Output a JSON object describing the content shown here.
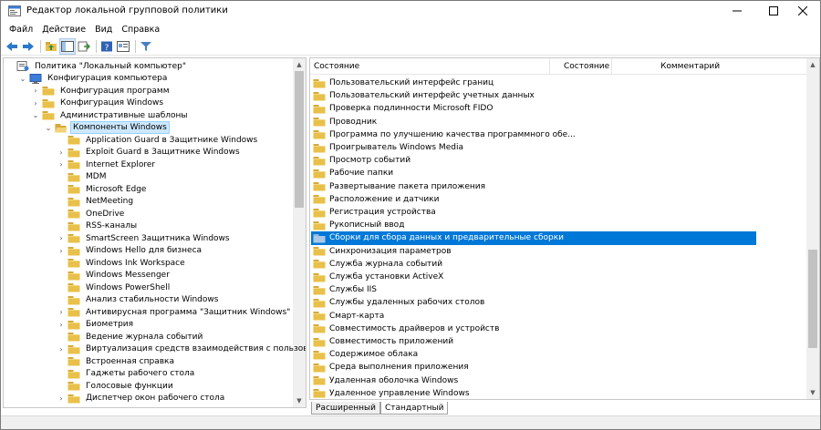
{
  "window": {
    "title": "Редактор локальной групповой политики"
  },
  "menu": [
    "Файл",
    "Действие",
    "Вид",
    "Справка"
  ],
  "toolbar": {
    "buttons": [
      "back-icon",
      "forward-icon",
      "up-folder-icon",
      "console-tree-icon",
      "export-list-icon",
      "help-icon",
      "properties-icon",
      "filter-icon"
    ]
  },
  "tree": {
    "items": [
      {
        "label": "Политика \"Локальный компьютер\"",
        "level": 0,
        "expander": "",
        "icon": "policy"
      },
      {
        "label": "Конфигурация компьютера",
        "level": 1,
        "expander": "▾",
        "icon": "computer"
      },
      {
        "label": "Конфигурация программ",
        "level": 2,
        "expander": "›",
        "icon": "folder"
      },
      {
        "label": "Конфигурация Windows",
        "level": 2,
        "expander": "›",
        "icon": "folder"
      },
      {
        "label": "Административные шаблоны",
        "level": 2,
        "expander": "▾",
        "icon": "folder"
      },
      {
        "label": "Компоненты Windows",
        "level": 3,
        "expander": "▾",
        "icon": "folder-open",
        "selected": true
      },
      {
        "label": "Application Guard в Защитнике Windows",
        "level": 4,
        "expander": "",
        "icon": "folder"
      },
      {
        "label": "Exploit Guard в Защитнике Windows",
        "level": 4,
        "expander": "›",
        "icon": "folder"
      },
      {
        "label": "Internet Explorer",
        "level": 4,
        "expander": "›",
        "icon": "folder"
      },
      {
        "label": "MDM",
        "level": 4,
        "expander": "",
        "icon": "folder"
      },
      {
        "label": "Microsoft Edge",
        "level": 4,
        "expander": "",
        "icon": "folder"
      },
      {
        "label": "NetMeeting",
        "level": 4,
        "expander": "",
        "icon": "folder"
      },
      {
        "label": "OneDrive",
        "level": 4,
        "expander": "",
        "icon": "folder"
      },
      {
        "label": "RSS-каналы",
        "level": 4,
        "expander": "",
        "icon": "folder"
      },
      {
        "label": "SmartScreen Защитника Windows",
        "level": 4,
        "expander": "›",
        "icon": "folder"
      },
      {
        "label": "Windows Hello для бизнеса",
        "level": 4,
        "expander": "›",
        "icon": "folder"
      },
      {
        "label": "Windows Ink Workspace",
        "level": 4,
        "expander": "",
        "icon": "folder"
      },
      {
        "label": "Windows Messenger",
        "level": 4,
        "expander": "",
        "icon": "folder"
      },
      {
        "label": "Windows PowerShell",
        "level": 4,
        "expander": "",
        "icon": "folder"
      },
      {
        "label": "Анализ стабильности Windows",
        "level": 4,
        "expander": "",
        "icon": "folder"
      },
      {
        "label": "Антивирусная программа \"Защитник Windows\"",
        "level": 4,
        "expander": "›",
        "icon": "folder"
      },
      {
        "label": "Биометрия",
        "level": 4,
        "expander": "›",
        "icon": "folder"
      },
      {
        "label": "Ведение журнала событий",
        "level": 4,
        "expander": "",
        "icon": "folder"
      },
      {
        "label": "Виртуализация средств взаимодействия с пользователем (",
        "level": 4,
        "expander": "›",
        "icon": "folder"
      },
      {
        "label": "Встроенная справка",
        "level": 4,
        "expander": "",
        "icon": "folder"
      },
      {
        "label": "Гаджеты рабочего стола",
        "level": 4,
        "expander": "",
        "icon": "folder"
      },
      {
        "label": "Голосовые функции",
        "level": 4,
        "expander": "",
        "icon": "folder"
      },
      {
        "label": "Диспетчер окон рабочего стола",
        "level": 4,
        "expander": "›",
        "icon": "folder"
      }
    ]
  },
  "list": {
    "columns": [
      "Состояние",
      "Состояние",
      "Комментарий"
    ],
    "rows": [
      {
        "label": "Пользовательский интерфейс границ"
      },
      {
        "label": "Пользовательский интерфейс учетных данных"
      },
      {
        "label": "Проверка подлинности Microsoft FIDO"
      },
      {
        "label": "Проводник"
      },
      {
        "label": "Программа по улучшению качества программного обе..."
      },
      {
        "label": "Проигрыватель Windows Media"
      },
      {
        "label": "Просмотр событий"
      },
      {
        "label": "Рабочие папки"
      },
      {
        "label": "Развертывание пакета приложения"
      },
      {
        "label": "Расположение и датчики"
      },
      {
        "label": "Регистрация устройства"
      },
      {
        "label": "Рукописный ввод"
      },
      {
        "label": "Сборки для сбора данных и предварительные сборки",
        "selected": true
      },
      {
        "label": "Синхронизация параметров"
      },
      {
        "label": "Служба журнала событий"
      },
      {
        "label": "Служба установки ActiveX"
      },
      {
        "label": "Службы IIS"
      },
      {
        "label": "Службы удаленных рабочих столов"
      },
      {
        "label": "Смарт-карта"
      },
      {
        "label": "Совместимость драйверов и устройств"
      },
      {
        "label": "Совместимость приложений"
      },
      {
        "label": "Содержимое облака"
      },
      {
        "label": "Среда выполнения приложения"
      },
      {
        "label": "Удаленная оболочка Windows"
      },
      {
        "label": "Удаленное управление Windows"
      }
    ]
  },
  "tabs": [
    "Расширенный",
    "Стандартный"
  ],
  "colors": {
    "selection": "#0078d7",
    "tree_selection": "#cce8ff",
    "folder": "#e8c04a"
  }
}
